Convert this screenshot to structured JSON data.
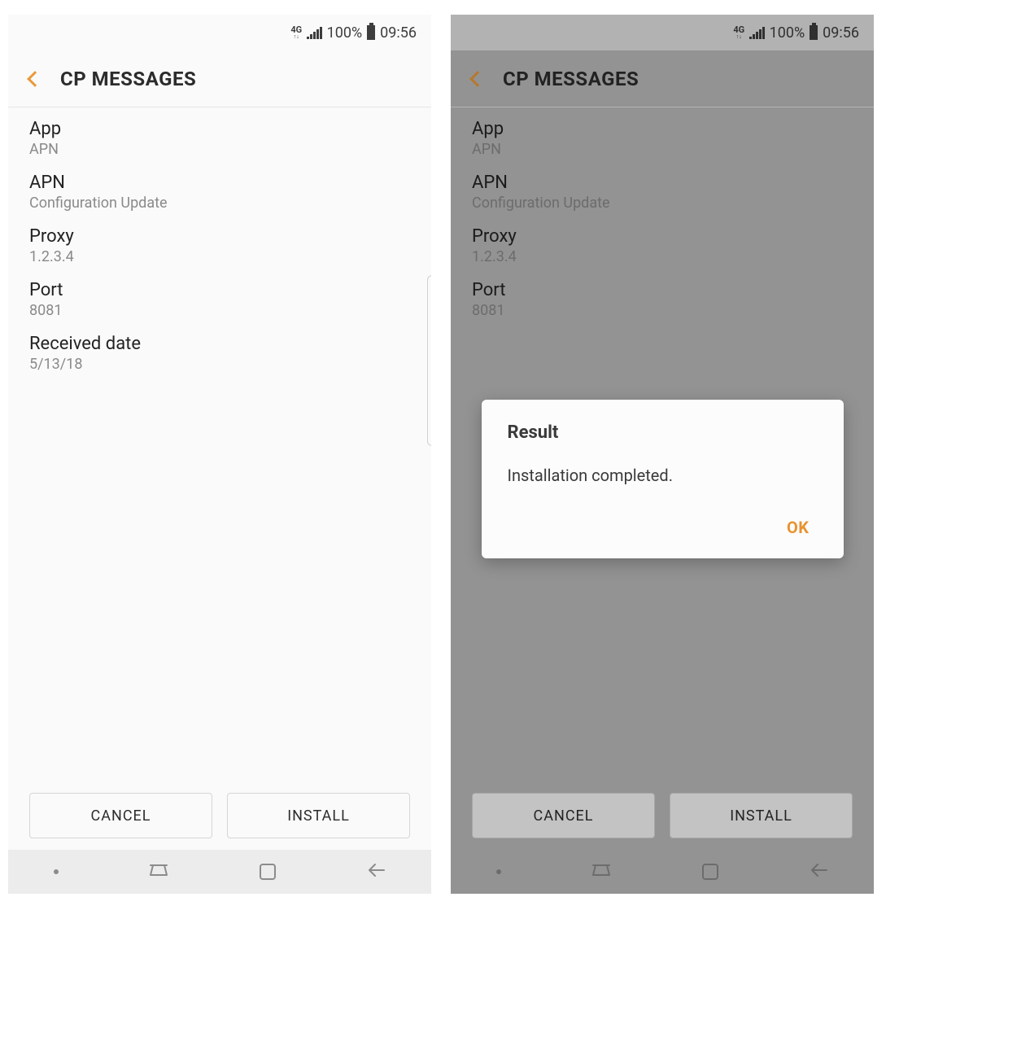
{
  "status": {
    "network": "4G",
    "battery_pct": "100%",
    "time": "09:56"
  },
  "header": {
    "title": "CP MESSAGES"
  },
  "details": {
    "app_label": "App",
    "app_value": "APN",
    "apn_label": "APN",
    "apn_value": "Configuration Update",
    "proxy_label": "Proxy",
    "proxy_value": "1.2.3.4",
    "port_label": "Port",
    "port_value": "8081",
    "received_label": "Received date",
    "received_value": "5/13/18"
  },
  "footer": {
    "cancel": "CANCEL",
    "install": "INSTALL"
  },
  "dialog": {
    "title": "Result",
    "message": "Installation completed.",
    "ok": "OK"
  }
}
